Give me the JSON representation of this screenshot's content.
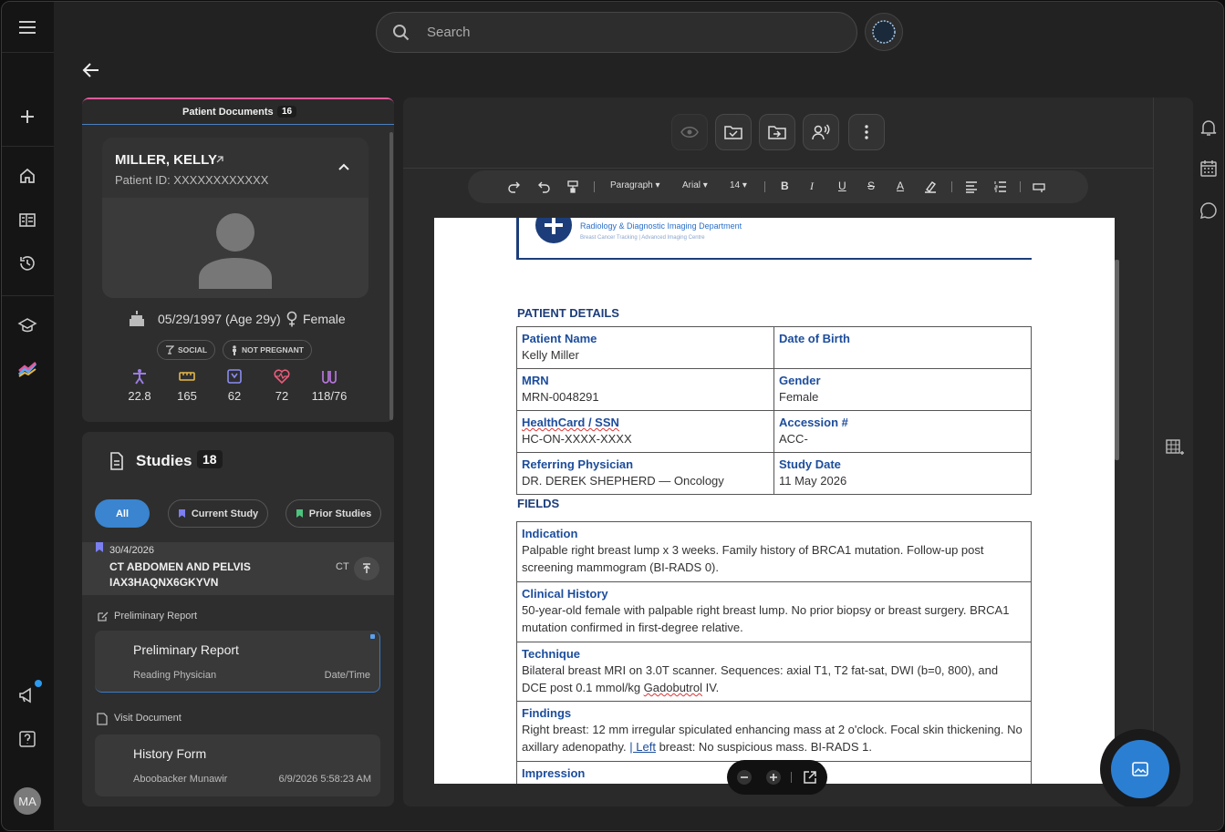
{
  "search": {
    "placeholder": "Search"
  },
  "user": {
    "initials": "MA"
  },
  "patient_documents": {
    "title": "Patient Documents",
    "count": "16"
  },
  "patient": {
    "name": "MILLER, KELLY",
    "id": "Patient ID: XXXXXXXXXXXX",
    "dob": "05/29/1997 (Age 29y)",
    "gender": "Female",
    "chips": [
      "SOCIAL",
      "NOT PREGNANT"
    ],
    "vitals": [
      {
        "icon": "bmi-icon",
        "value": "22.8",
        "color": "#9b7ce6"
      },
      {
        "icon": "height-icon",
        "value": "165",
        "color": "#e6b84a"
      },
      {
        "icon": "weight-icon",
        "value": "62",
        "color": "#8a8cf0"
      },
      {
        "icon": "heart-rate-icon",
        "value": "72",
        "color": "#e85d7a"
      },
      {
        "icon": "blood-pressure-icon",
        "value": "118/76",
        "color": "#c07ae6"
      }
    ]
  },
  "studies": {
    "title": "Studies",
    "count": "18",
    "tabs": {
      "all": "All",
      "current": "Current Study",
      "prior": "Prior Studies"
    },
    "current_study": {
      "date": "30/4/2026",
      "name": "CT ABDOMEN AND PELVIS",
      "accession": "IAX3HAQNX6GKYVN",
      "modality": "CT"
    },
    "preliminary_label": "Preliminary Report",
    "preliminary": {
      "title": "Preliminary Report",
      "physician": "Reading Physician",
      "datetime": "Date/Time"
    },
    "visit_label": "Visit Document",
    "visit": {
      "title": "History Form",
      "author": "Aboobacker Munawir",
      "datetime": "6/9/2026 5:58:23 AM"
    }
  },
  "format_bar": {
    "paragraph": "Paragraph ▾",
    "font": "Arial ▾",
    "size": "14 ▾"
  },
  "document": {
    "dept": "Radiology & Diagnostic Imaging Department",
    "subline": "Breast Cancer Tracking  |  Advanced Imaging Centre",
    "patient_details_title": "PATIENT DETAILS",
    "details": {
      "patient_name_label": "Patient Name",
      "patient_name": "Kelly Miller",
      "dob_label": "Date of Birth",
      "dob": "",
      "mrn_label": "MRN",
      "mrn": "MRN-0048291",
      "gender_label": "Gender",
      "gender": "Female",
      "healthcard_label": "HealthCard / SSN",
      "healthcard": "HC-ON-XXXX-XXXX",
      "accession_label": "Accession #",
      "accession": "ACC-",
      "referring_label": "Referring Physician",
      "referring": "DR. DEREK SHEPHERD — Oncology",
      "study_date_label": "Study Date",
      "study_date": "11 May 2026"
    },
    "fields_title": "FIELDS",
    "fields": {
      "indication_label": "Indication",
      "indication": "Palpable right breast lump x 3 weeks. Family history of BRCA1 mutation. Follow-up post screening mammogram (BI-RADS 0).",
      "history_label": "Clinical History",
      "history": "50-year-old female with palpable right breast lump. No prior biopsy or breast surgery. BRCA1 mutation confirmed in first-degree relative.",
      "technique_label": "Technique",
      "technique_a": "Bilateral breast MRI on 3.0T scanner. Sequences: axial T1, T2 fat-sat, DWI (b=0, 800), and DCE post 0.1 mmol/kg ",
      "technique_b": "Gadobutrol",
      "technique_c": " IV.",
      "findings_label": "Findings",
      "findings_a": "Right breast: 12 mm irregular spiculated enhancing mass at 2 o'clock. Focal skin thickening. No axillary adenopathy. ",
      "findings_b": "| Left",
      "findings_c": " breast: No suspicious mass. BI-RADS 1.",
      "impression_label": "Impression"
    }
  },
  "colors": {
    "accent": "#2b7fd3",
    "doc_blue": "#1c4d9c",
    "pink": "#e05a9b"
  }
}
